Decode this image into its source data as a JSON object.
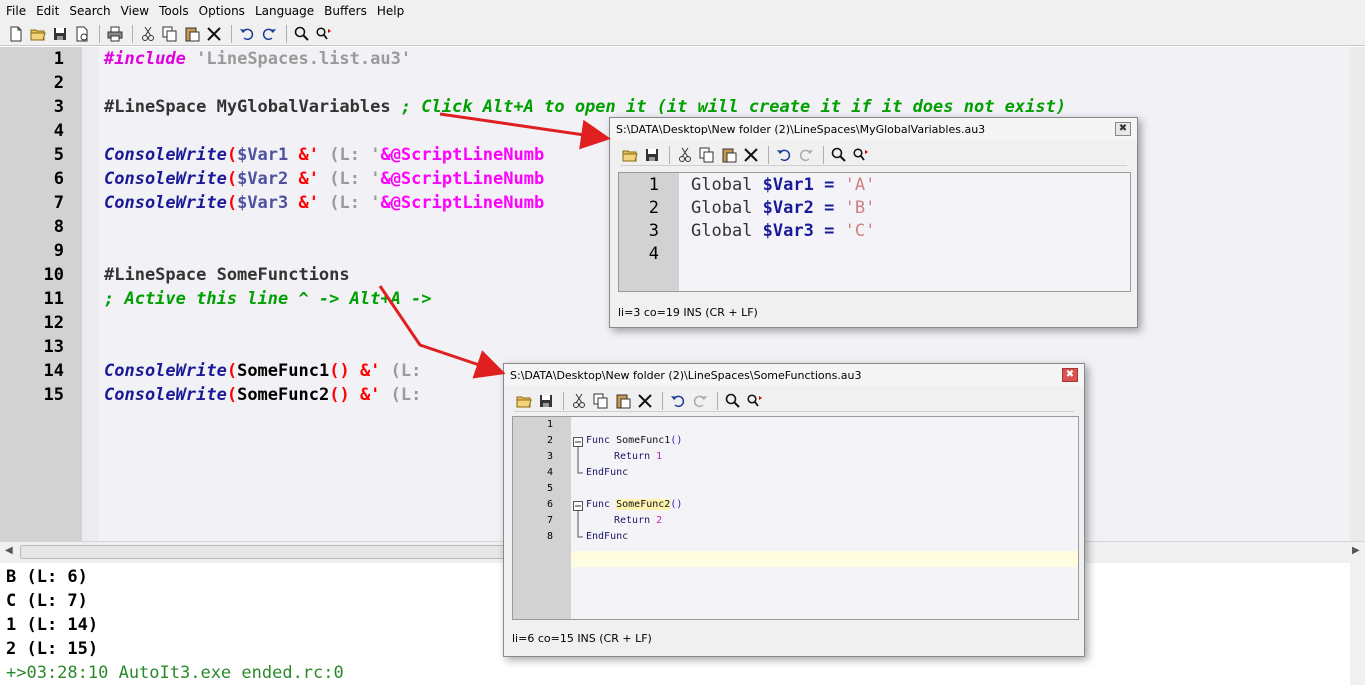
{
  "menu": [
    "File",
    "Edit",
    "Search",
    "View",
    "Tools",
    "Options",
    "Language",
    "Buffers",
    "Help"
  ],
  "editor": {
    "line_numbers": [
      "1",
      "2",
      "3",
      "4",
      "5",
      "6",
      "7",
      "8",
      "9",
      "10",
      "11",
      "12",
      "13",
      "14",
      "15"
    ],
    "l1_inc": "#include",
    "l1_str": "'LineSpaces.list.au3'",
    "l3_dir": "#LineSpace MyGlobalVariables",
    "l3_cmt": "; Click Alt+A to open it (it will create it if it does not exist)",
    "fn_console": "ConsoleWrite",
    "l5_var": "$Var1",
    "l6_var": "$Var2",
    "l7_var": "$Var3",
    "amp_q": "&'",
    "l_lbl": "(L: '",
    "mac_partial": "&@ScriptLineNumb",
    "l10_dir": "#LineSpace SomeFunctions",
    "l11_cmt": "; Active this line ^ -> Alt+A ->",
    "l14_call": "SomeFunc1",
    "l15_call": "SomeFunc2",
    "parens": "()",
    "amp2": "&'",
    "l_lbl2": "(L:"
  },
  "output": {
    "lines": [
      "B (L: 6)",
      "C (L: 7)",
      "1 (L: 14)",
      "2 (L: 15)"
    ],
    "ended": "+>03:28:10 AutoIt3.exe ended.rc:0"
  },
  "popup1": {
    "title": "S:\\DATA\\Desktop\\New folder (2)\\LineSpaces\\MyGlobalVariables.au3",
    "line_numbers": [
      "1",
      "2",
      "3",
      "4"
    ],
    "kw": "Global",
    "vars": [
      "$Var1",
      "$Var2",
      "$Var3"
    ],
    "eq": "=",
    "vals": [
      "'A'",
      "'B'",
      "'C'"
    ],
    "status": "li=3 co=19 INS (CR + LF)"
  },
  "popup2": {
    "title": "S:\\DATA\\Desktop\\New folder (2)\\LineSpaces\\SomeFunctions.au3",
    "line_numbers": [
      "1",
      "2",
      "3",
      "4",
      "5",
      "6",
      "7",
      "8"
    ],
    "func_kw": "Func",
    "name1": "SomeFunc1",
    "name2": "SomeFunc2",
    "parens": "()",
    "ret_kw": "Return",
    "ret1": "1",
    "ret2": "2",
    "endfunc": "EndFunc",
    "status": "li=6 co=15 INS (CR + LF)"
  },
  "colors": {
    "include": "#e000e0",
    "comment": "#00a000",
    "keyword": "#1a1a99",
    "macro": "#ff00ff",
    "operator": "#ff0000",
    "gutter": "#d2d2d2",
    "arrow": "#e02020",
    "highlight_line": "#fffde0"
  },
  "icons": [
    "new-file-icon",
    "open-folder-icon",
    "save-icon",
    "save-as-icon",
    "print-icon",
    "cut-icon",
    "copy-icon",
    "paste-icon",
    "delete-icon",
    "undo-icon",
    "redo-icon",
    "find-icon",
    "replace-icon",
    "close-icon"
  ]
}
